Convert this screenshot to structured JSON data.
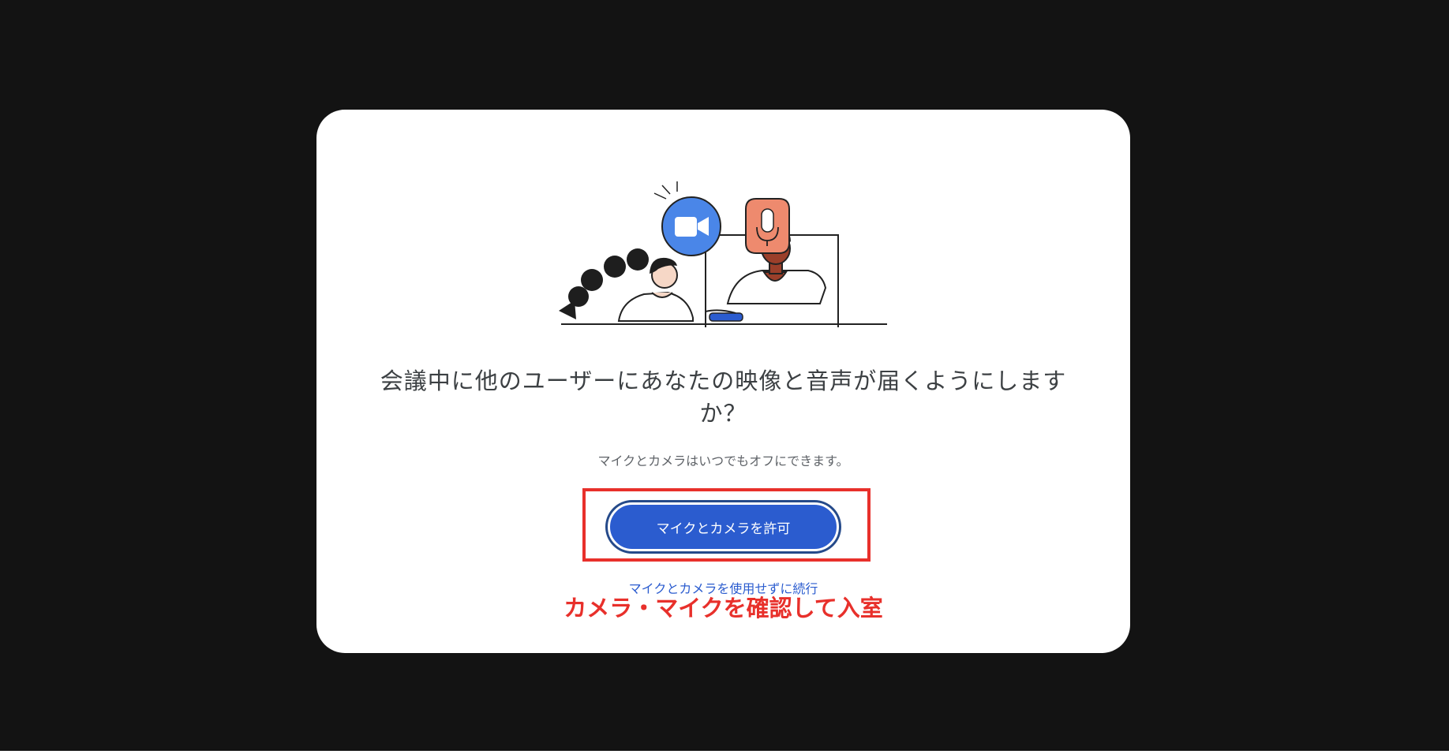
{
  "dialog": {
    "heading": "会議中に他のユーザーにあなたの映像と音声が届くようにしますか？",
    "subtext": "マイクとカメラはいつでもオフにできます。",
    "allow_button_label": "マイクとカメラを許可",
    "continue_link_label": "マイクとカメラを使用せずに続行"
  },
  "annotation": {
    "text": "カメラ・マイクを確認して入室",
    "color": "#e8302b"
  },
  "icons": {
    "camera": "video-camera-icon",
    "microphone": "microphone-icon"
  },
  "colors": {
    "backdrop": "#131313",
    "primary_button": "#2b5ccf",
    "camera_bubble": "#4a86e8",
    "mic_bubble": "#ee8a6e"
  }
}
